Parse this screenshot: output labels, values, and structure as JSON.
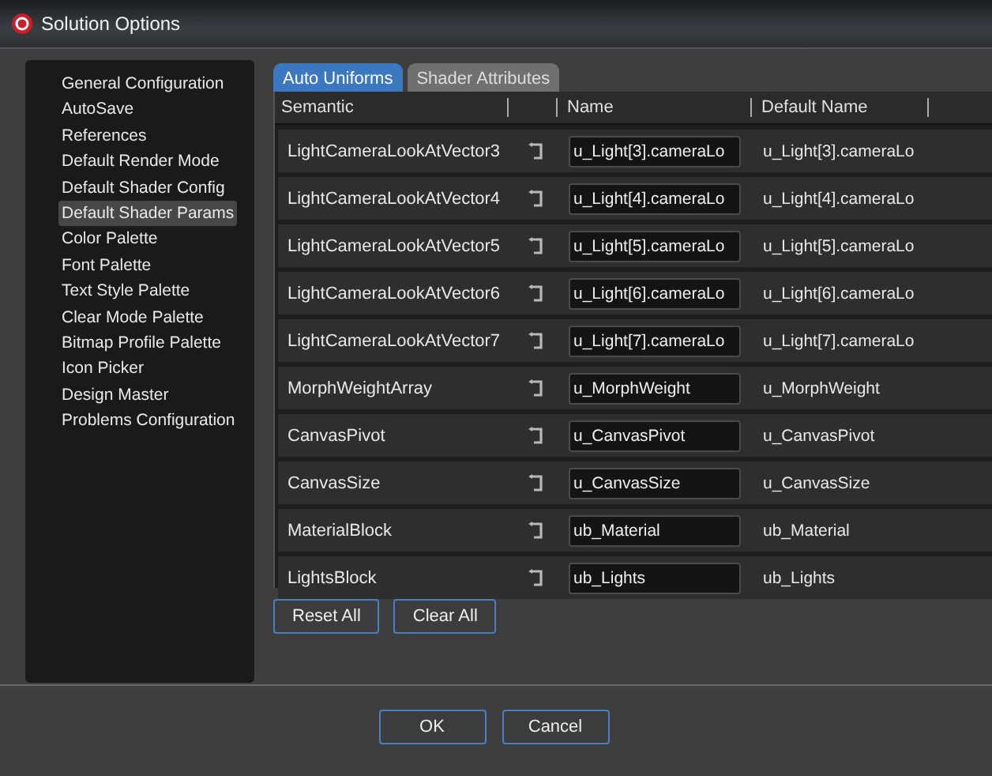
{
  "window": {
    "title": "Solution Options"
  },
  "sidebar": {
    "items": [
      {
        "label": "General Configuration",
        "selected": false
      },
      {
        "label": "AutoSave",
        "selected": false
      },
      {
        "label": "References",
        "selected": false
      },
      {
        "label": "Default Render Mode",
        "selected": false
      },
      {
        "label": "Default Shader Config",
        "selected": false
      },
      {
        "label": "Default Shader Params",
        "selected": true
      },
      {
        "label": "Color Palette",
        "selected": false
      },
      {
        "label": "Font Palette",
        "selected": false
      },
      {
        "label": "Text Style Palette",
        "selected": false
      },
      {
        "label": "Clear Mode Palette",
        "selected": false
      },
      {
        "label": "Bitmap Profile Palette",
        "selected": false
      },
      {
        "label": "Icon Picker",
        "selected": false
      },
      {
        "label": "Design Master",
        "selected": false
      },
      {
        "label": "Problems Configuration",
        "selected": false
      }
    ]
  },
  "tabs": [
    {
      "label": "Auto Uniforms",
      "selected": true
    },
    {
      "label": "Shader Attributes",
      "selected": false
    }
  ],
  "table": {
    "columns": [
      "Semantic",
      "Name",
      "Default Name"
    ],
    "rows": [
      {
        "semantic": "LightCameraLookAtVector3",
        "name": "u_Light[3].cameraLo",
        "default_name": "u_Light[3].cameraLo"
      },
      {
        "semantic": "LightCameraLookAtVector4",
        "name": "u_Light[4].cameraLo",
        "default_name": "u_Light[4].cameraLo"
      },
      {
        "semantic": "LightCameraLookAtVector5",
        "name": "u_Light[5].cameraLo",
        "default_name": "u_Light[5].cameraLo"
      },
      {
        "semantic": "LightCameraLookAtVector6",
        "name": "u_Light[6].cameraLo",
        "default_name": "u_Light[6].cameraLo"
      },
      {
        "semantic": "LightCameraLookAtVector7",
        "name": "u_Light[7].cameraLo",
        "default_name": "u_Light[7].cameraLo"
      },
      {
        "semantic": "MorphWeightArray",
        "name": "u_MorphWeight",
        "default_name": "u_MorphWeight"
      },
      {
        "semantic": "CanvasPivot",
        "name": "u_CanvasPivot",
        "default_name": "u_CanvasPivot"
      },
      {
        "semantic": "CanvasSize",
        "name": "u_CanvasSize",
        "default_name": "u_CanvasSize"
      },
      {
        "semantic": "MaterialBlock",
        "name": "ub_Material",
        "default_name": "ub_Material"
      },
      {
        "semantic": "LightsBlock",
        "name": "ub_Lights",
        "default_name": "ub_Lights"
      }
    ]
  },
  "table_buttons": [
    "Reset All",
    "Clear All"
  ],
  "buttons": [
    "OK",
    "Cancel"
  ]
}
